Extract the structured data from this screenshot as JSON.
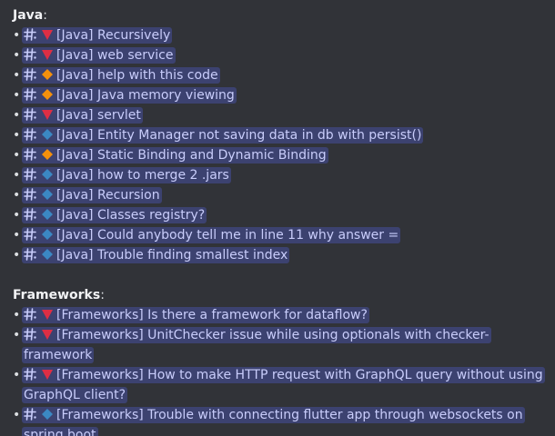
{
  "colors": {
    "background": "#313338",
    "chip_background": "#3c4270",
    "chip_text": "#c9cdfb",
    "triangle_red": "#dd2e44",
    "diamond_orange": "#f4900c",
    "diamond_blue": "#3b88c3"
  },
  "icons": {
    "channel": "hash-thread-icon",
    "priority_high": "red-triangle-down-icon",
    "priority_medium": "orange-diamond-icon",
    "priority_low": "blue-diamond-icon"
  },
  "bullet": "•",
  "sections": [
    {
      "title": "Java",
      "colon": ":",
      "items": [
        {
          "icon": "down",
          "text": "[Java] Recursively"
        },
        {
          "icon": "down",
          "text": "[Java] web service"
        },
        {
          "icon": "orange",
          "text": "[Java] help with this code"
        },
        {
          "icon": "orange",
          "text": "[Java] Java memory viewing"
        },
        {
          "icon": "down",
          "text": "[Java] servlet"
        },
        {
          "icon": "blue",
          "text": "[Java] Entity Manager not saving data in db with persist()"
        },
        {
          "icon": "orange",
          "text": "[Java] Static Binding and Dynamic Binding"
        },
        {
          "icon": "blue",
          "text": "[Java] how to merge 2 .jars"
        },
        {
          "icon": "blue",
          "text": "[Java] Recursion"
        },
        {
          "icon": "blue",
          "text": "[Java] Classes registry?"
        },
        {
          "icon": "blue",
          "text": "[Java] Could anybody tell me in line 11 why  answer ="
        },
        {
          "icon": "blue",
          "text": "[Java] Trouble finding smallest index"
        }
      ]
    },
    {
      "title": "Frameworks",
      "colon": ":",
      "items": [
        {
          "icon": "down",
          "text": "[Frameworks] Is there a framework for dataflow?"
        },
        {
          "icon": "down",
          "text": "[Frameworks] UnitChecker issue while using optionals with checker-framework"
        },
        {
          "icon": "down",
          "text": "[Frameworks] How to make HTTP request with GraphQL query without using GraphQL client?"
        },
        {
          "icon": "blue",
          "text": "[Frameworks] Trouble with connecting flutter app through websockets on spring boot"
        }
      ]
    }
  ]
}
